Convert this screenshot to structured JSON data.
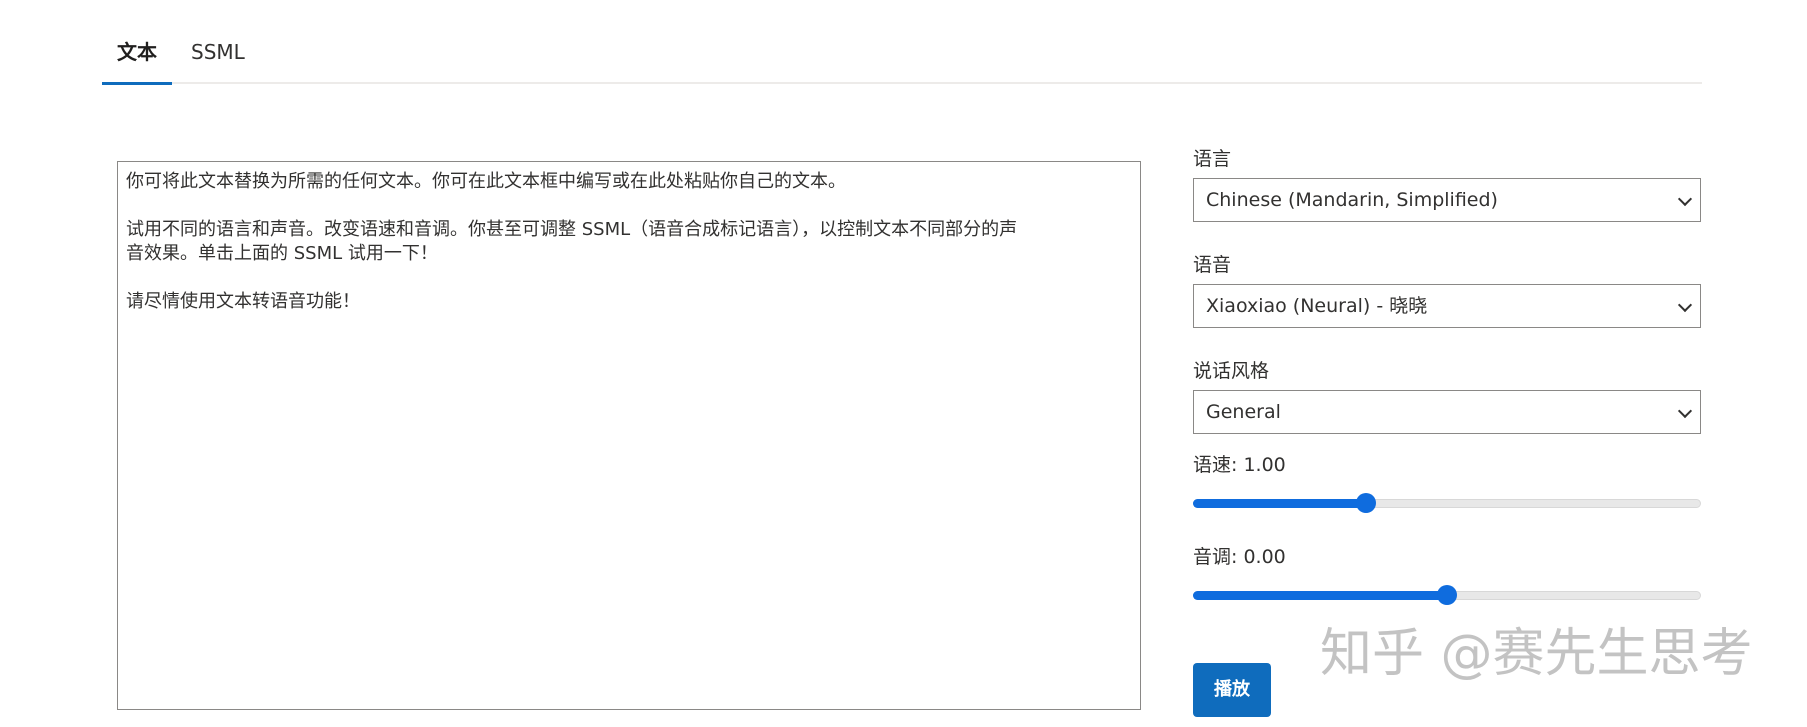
{
  "tabs": [
    {
      "label": "文本",
      "active": true
    },
    {
      "label": "SSML",
      "active": false
    }
  ],
  "editor": {
    "text": "你可将此文本替换为所需的任何文本。你可在此文本框中编写或在此处粘贴你自己的文本。\n\n试用不同的语言和声音。改变语速和音调。你甚至可调整 SSML（语音合成标记语言），以控制文本不同部分的声\n音效果。单击上面的 SSML 试用一下！\n\n请尽情使用文本转语音功能！"
  },
  "settings": {
    "language_label": "语言",
    "language_value": "Chinese (Mandarin, Simplified)",
    "voice_label": "语音",
    "voice_value": "Xiaoxiao (Neural) - 晓晓",
    "style_label": "说话风格",
    "style_value": "General",
    "rate_label": "语速: 1.00",
    "rate_fraction": 0.34,
    "pitch_label": "音调: 0.00",
    "pitch_fraction": 0.5,
    "play_label": "播放"
  },
  "watermark": "知乎 @赛先生思考",
  "colors": {
    "accent": "#0f6cbd",
    "slider": "#0f6cde"
  }
}
